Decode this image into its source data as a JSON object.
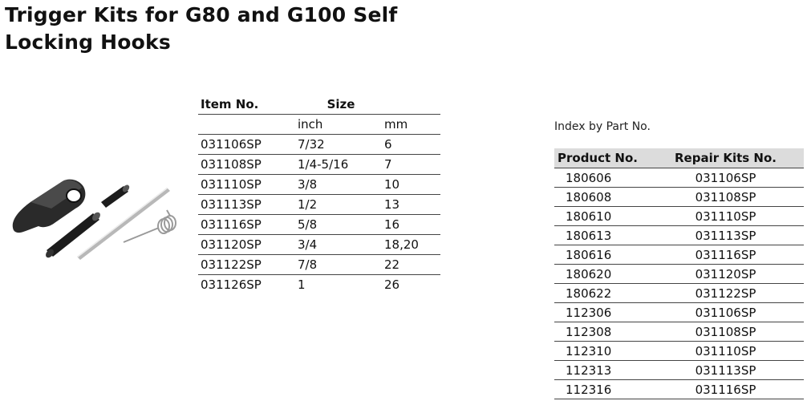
{
  "title": "Trigger Kits for G80 and G100 Self Locking Hooks",
  "item_table": {
    "headers": {
      "item": "Item No.",
      "size": "Size",
      "inch": "inch",
      "mm": "mm"
    },
    "rows": [
      {
        "item": "031106SP",
        "inch": "7/32",
        "mm": "6"
      },
      {
        "item": "031108SP",
        "inch": "1/4-5/16",
        "mm": "7"
      },
      {
        "item": "031110SP",
        "inch": "3/8",
        "mm": "10"
      },
      {
        "item": "031113SP",
        "inch": "1/2",
        "mm": "13"
      },
      {
        "item": "031116SP",
        "inch": "5/8",
        "mm": "16"
      },
      {
        "item": "031120SP",
        "inch": "3/4",
        "mm": "18,20"
      },
      {
        "item": "031122SP",
        "inch": "7/8",
        "mm": "22"
      },
      {
        "item": "031126SP",
        "inch": "1",
        "mm": "26"
      }
    ]
  },
  "index_table": {
    "caption": "Index by Part No.",
    "headers": {
      "product": "Product No.",
      "repair": "Repair Kits No."
    },
    "rows": [
      {
        "product": "180606",
        "repair": "031106SP"
      },
      {
        "product": "180608",
        "repair": "031108SP"
      },
      {
        "product": "180610",
        "repair": "031110SP"
      },
      {
        "product": "180613",
        "repair": "031113SP"
      },
      {
        "product": "180616",
        "repair": "031116SP"
      },
      {
        "product": "180620",
        "repair": "031120SP"
      },
      {
        "product": "180622",
        "repair": "031122SP"
      },
      {
        "product": "112306",
        "repair": "031106SP"
      },
      {
        "product": "112308",
        "repair": "031108SP"
      },
      {
        "product": "112310",
        "repair": "031110SP"
      },
      {
        "product": "112313",
        "repair": "031113SP"
      },
      {
        "product": "112316",
        "repair": "031116SP"
      }
    ]
  }
}
